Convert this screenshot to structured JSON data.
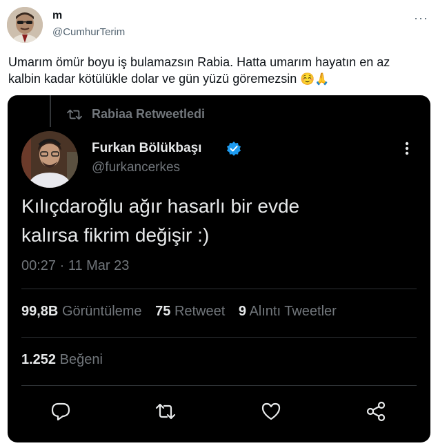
{
  "outer_tweet": {
    "author_name": "m",
    "author_handle": "@CumhurTerim",
    "more_menu": "···",
    "text_line1": "Umarım ömür boyu iş bulamazsın Rabia. Hatta umarım hayatın en az",
    "text_line2": "kalbin kadar kötülükle dolar ve gün yüzü göremezsin",
    "emoji": "☺️🙏"
  },
  "embedded_tweet": {
    "retweeted_by": "Rabiaa Retweetledi",
    "author_name": "Furkan Bölükbaşı",
    "author_handle": "@furkancerkes",
    "text_line1": "Kılıçdaroğlu ağır hasarlı bir evde",
    "text_line2": "kalırsa fikrim değişir :)",
    "timestamp": "00:27 · 11 Mar 23",
    "stats": {
      "views_count": "99,8B",
      "views_label": "Görüntüleme",
      "retweets_count": "75",
      "retweets_label": "Retweet",
      "quotes_count": "9",
      "quotes_label": "Alıntı Tweetler",
      "likes_count": "1.252",
      "likes_label": "Beğeni"
    },
    "verified_color": "#1d9bf0",
    "icons": [
      "retweet-icon",
      "verified-badge-icon",
      "more-options-icon",
      "reply-icon",
      "retweet-action-icon",
      "like-icon",
      "share-icon"
    ]
  }
}
